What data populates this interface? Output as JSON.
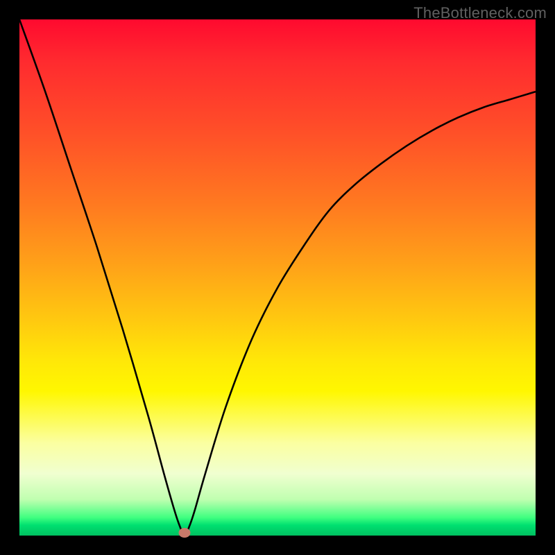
{
  "watermark": "TheBottleneck.com",
  "chart_data": {
    "type": "line",
    "title": "",
    "xlabel": "",
    "ylabel": "",
    "xlim": [
      0,
      100
    ],
    "ylim": [
      0,
      100
    ],
    "grid": false,
    "legend": false,
    "gradient_meaning": "vertical: red = high bottleneck, green = no bottleneck",
    "optimum_x": 32,
    "marker": {
      "x": 32,
      "y": 0.5,
      "color": "#c97a6a"
    },
    "series": [
      {
        "name": "bottleneck-curve",
        "color": "#000000",
        "x": [
          0,
          5,
          10,
          15,
          20,
          25,
          28,
          30,
          31,
          32,
          33,
          34,
          36,
          40,
          45,
          50,
          55,
          60,
          65,
          70,
          75,
          80,
          85,
          90,
          95,
          100
        ],
        "values": [
          100,
          86,
          71,
          56,
          40,
          23,
          12,
          5,
          2,
          0,
          2,
          5,
          12,
          25,
          38,
          48,
          56,
          63,
          68,
          72,
          75.5,
          78.5,
          81,
          83,
          84.5,
          86
        ]
      }
    ],
    "background_stops": [
      {
        "pos": 0.0,
        "color": "#ff0a2f"
      },
      {
        "pos": 0.08,
        "color": "#ff2a2f"
      },
      {
        "pos": 0.22,
        "color": "#ff5028"
      },
      {
        "pos": 0.36,
        "color": "#ff7a20"
      },
      {
        "pos": 0.48,
        "color": "#ffa318"
      },
      {
        "pos": 0.58,
        "color": "#ffc810"
      },
      {
        "pos": 0.66,
        "color": "#ffe708"
      },
      {
        "pos": 0.72,
        "color": "#fff700"
      },
      {
        "pos": 0.82,
        "color": "#fbffa0"
      },
      {
        "pos": 0.88,
        "color": "#f0ffd0"
      },
      {
        "pos": 0.93,
        "color": "#c0ffb0"
      },
      {
        "pos": 0.965,
        "color": "#40ff80"
      },
      {
        "pos": 0.98,
        "color": "#00e070"
      },
      {
        "pos": 1.0,
        "color": "#00c060"
      }
    ]
  }
}
